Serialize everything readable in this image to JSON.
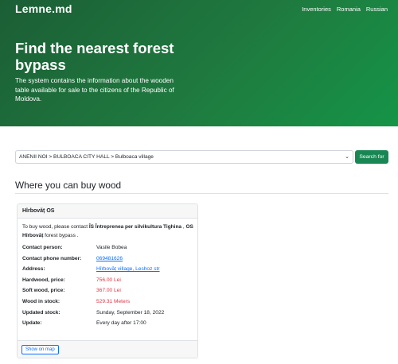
{
  "header": {
    "brand": "Lemne.md",
    "nav": [
      "Inventories",
      "Romania",
      "Russian"
    ]
  },
  "hero": {
    "title": "Find the nearest forest bypass",
    "text": "The system contains the information about the wooden table available for sale to the citizens of the Republic of Moldova."
  },
  "search": {
    "selected": "ANENII NOI > BULBOACA CITY HALL > Bulboaca village",
    "button": "Search for"
  },
  "section_title": "Where you can buy wood",
  "card": {
    "title": "Hîrbovăț OS",
    "intro_pre": "To buy wood, please contact ",
    "intro_org": "ÎS Întreprenea per silvikultura Tighina",
    "intro_mid": " , ",
    "intro_unit": "OS Hîrbovăț",
    "intro_post": " forest bypass .",
    "rows": [
      {
        "label": "Contact person:",
        "value": "Vasile Bobea"
      },
      {
        "label": "Contact phone number:",
        "value": "069481626"
      },
      {
        "label": "Address:",
        "value": "Hîrbovăț village, Leshoz str"
      },
      {
        "label": "Hardwood, price:",
        "value": "756.00 Lei"
      },
      {
        "label": "Soft wood, price:",
        "value": "367.00 Lei"
      },
      {
        "label": "Wood in stock:",
        "value": "529.31 Meters"
      },
      {
        "label": "Updated stock:",
        "value": "Sunday, September 18, 2022"
      },
      {
        "label": "Update:",
        "value": "Every day after 17:00"
      }
    ],
    "map_button": "Show on map"
  },
  "colors": {
    "hero_green": "#1f7a3f",
    "button_green": "#198754",
    "link_blue": "#0d6efd",
    "price_red": "#dc3545"
  }
}
